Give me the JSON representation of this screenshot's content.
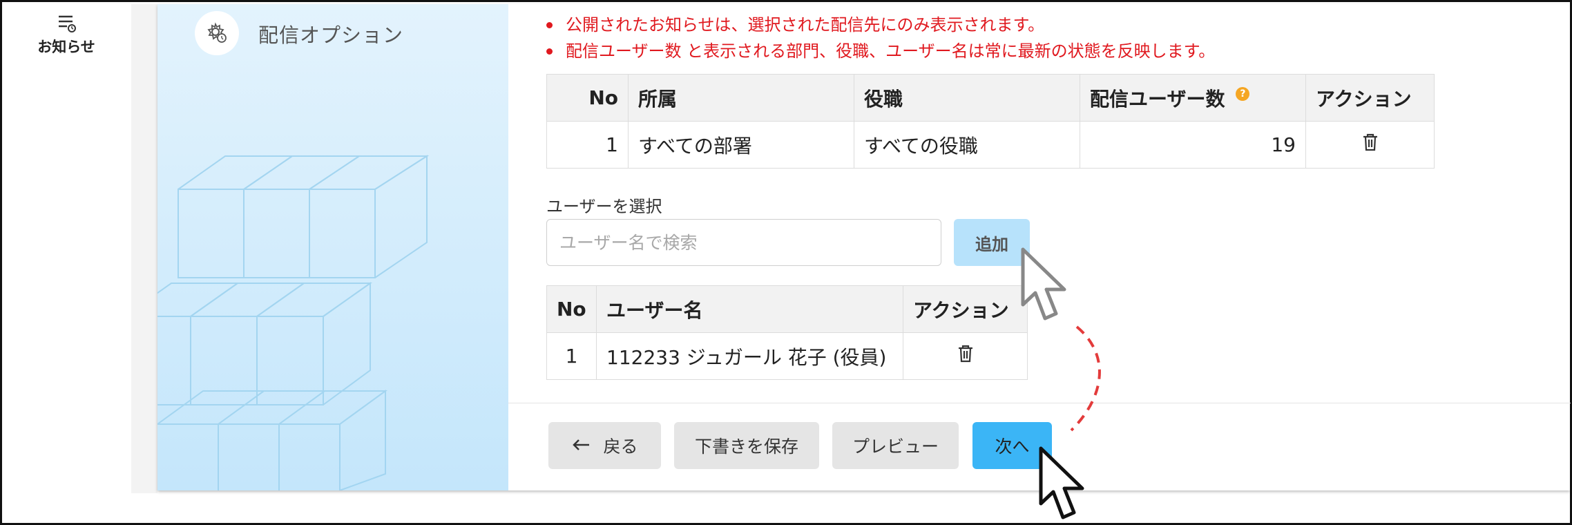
{
  "nav": {
    "notice_label": "お知らせ"
  },
  "side_panel": {
    "title": "配信オプション"
  },
  "notes": [
    "公開されたお知らせは、選択された配信先にのみ表示されます。",
    "配信ユーザー数 と表示される部門、役職、ユーザー名は常に最新の状態を反映します。"
  ],
  "distribution_table": {
    "headers": [
      "No",
      "所属",
      "役職",
      "配信ユーザー数",
      "アクション"
    ],
    "rows": [
      {
        "no": "1",
        "department": "すべての部署",
        "position": "すべての役職",
        "user_count": "19"
      }
    ]
  },
  "user_select": {
    "label": "ユーザーを選択",
    "search_placeholder": "ユーザー名で検索",
    "add_button": "追加"
  },
  "user_table": {
    "headers": [
      "No",
      "ユーザー名",
      "アクション"
    ],
    "rows": [
      {
        "no": "1",
        "user_name": "112233 ジュガール 花子 (役員)"
      }
    ]
  },
  "footer": {
    "back_button": "戻る",
    "save_draft_button": "下書きを保存",
    "preview_button": "プレビュー",
    "next_button": "次へ"
  },
  "colors": {
    "note_red": "#e0191f",
    "next_button_blue": "#3bb5f6",
    "add_button_blue": "#b7e2fb",
    "side_panel_blue": "#c4e6fb",
    "help_icon_orange": "#f5a623"
  }
}
